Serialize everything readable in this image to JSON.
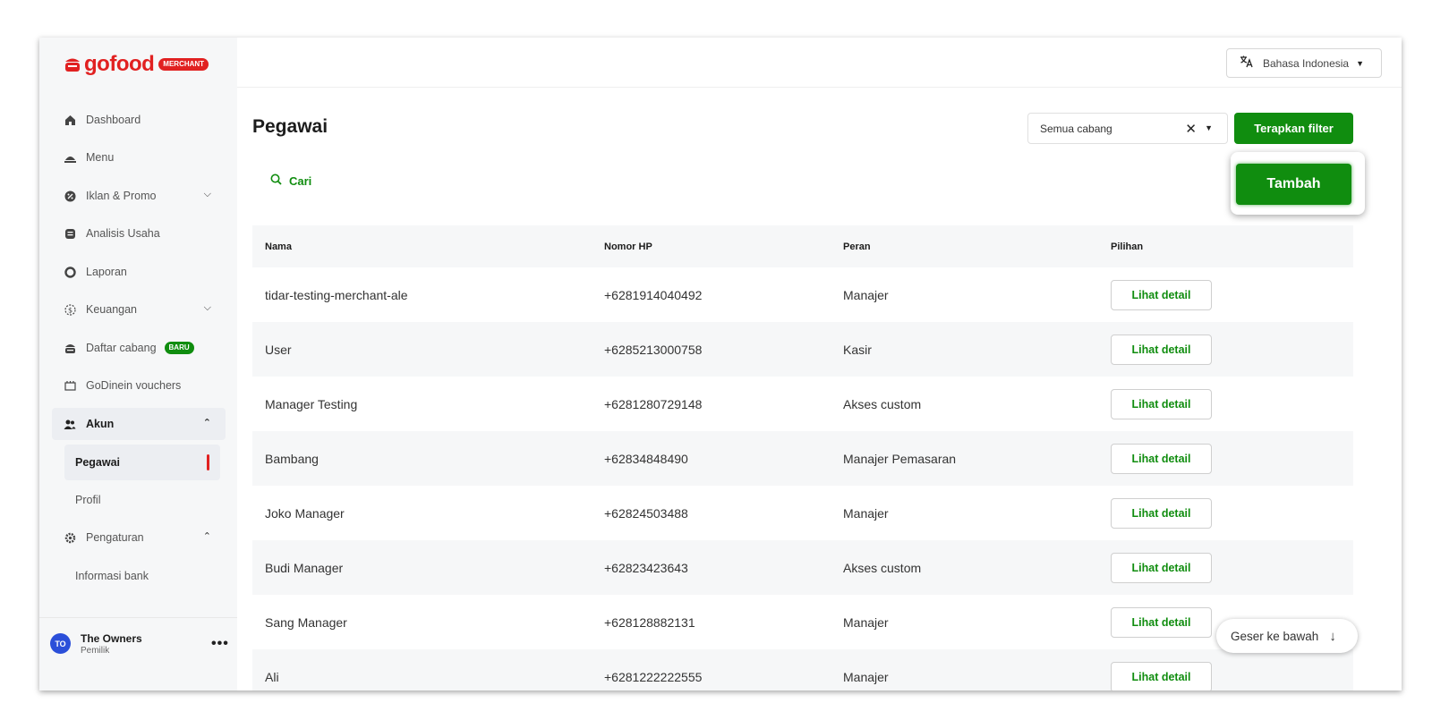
{
  "brand": {
    "name": "gofood",
    "badge": "MERCHANT",
    "color": "#e12121"
  },
  "accent": "#108d0f",
  "sidebar": {
    "items": [
      {
        "label": "Dashboard",
        "icon": "home-icon"
      },
      {
        "label": "Menu",
        "icon": "dish-icon"
      },
      {
        "label": "Iklan & Promo",
        "icon": "promo-icon",
        "expandable": true
      },
      {
        "label": "Analisis Usaha",
        "icon": "analytics-icon"
      },
      {
        "label": "Laporan",
        "icon": "report-icon"
      },
      {
        "label": "Keuangan",
        "icon": "finance-icon",
        "expandable": true
      },
      {
        "label": "Daftar cabang",
        "icon": "store-icon",
        "badge": "BARU"
      },
      {
        "label": "GoDinein vouchers",
        "icon": "voucher-icon"
      },
      {
        "label": "Akun",
        "icon": "users-icon",
        "expanded": true
      },
      {
        "label": "Pengaturan",
        "icon": "gear-icon",
        "expanded": true
      }
    ],
    "akun_sub": [
      "Pegawai",
      "Profil"
    ],
    "pengaturan_sub": [
      "Informasi bank"
    ],
    "owner": {
      "initials": "TO",
      "name": "The Owners",
      "role": "Pemilik"
    }
  },
  "topbar": {
    "language": "Bahasa Indonesia"
  },
  "main": {
    "title": "Pegawai",
    "branch_filter": "Semua cabang",
    "apply_label": "Terapkan filter",
    "add_label": "Tambah",
    "search_label": "Cari",
    "columns": [
      "Nama",
      "Nomor HP",
      "Peran",
      "Pilihan"
    ],
    "detail_label": "Lihat detail",
    "rows": [
      {
        "name": "tidar-testing-merchant-ale",
        "phone": "+6281914040492",
        "role": "Manajer"
      },
      {
        "name": "User",
        "phone": "+6285213000758",
        "role": "Kasir"
      },
      {
        "name": "Manager Testing",
        "phone": "+6281280729148",
        "role": "Akses custom"
      },
      {
        "name": "Bambang",
        "phone": "+62834848490",
        "role": "Manajer Pemasaran"
      },
      {
        "name": "Joko Manager",
        "phone": "+62824503488",
        "role": "Manajer"
      },
      {
        "name": "Budi Manager",
        "phone": "+62823423643",
        "role": "Akses custom"
      },
      {
        "name": "Sang Manager",
        "phone": "+628128882131",
        "role": "Manajer"
      },
      {
        "name": "Ali",
        "phone": "+6281222222555",
        "role": "Manajer"
      }
    ],
    "scroll_hint": "Geser ke bawah"
  }
}
